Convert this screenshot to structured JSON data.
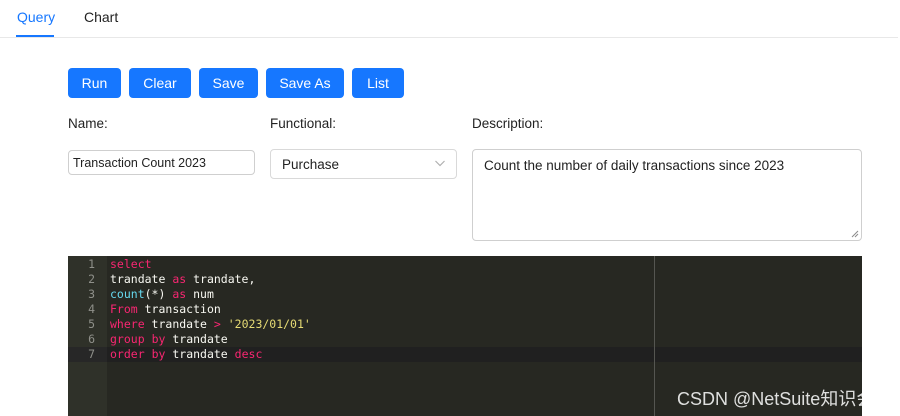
{
  "tabs": {
    "query": "Query",
    "chart": "Chart"
  },
  "toolbar": {
    "run": "Run",
    "clear": "Clear",
    "save": "Save",
    "save_as": "Save As",
    "list": "List"
  },
  "form": {
    "name_label": "Name:",
    "name_value": "Transaction Count 2023",
    "functional_label": "Functional:",
    "functional_value": "Purchase",
    "description_label": "Description:",
    "description_value": "Count the number of daily transactions since 2023"
  },
  "editor": {
    "lines": [
      {
        "n": "1",
        "tokens": [
          {
            "t": "select",
            "c": "kw"
          }
        ]
      },
      {
        "n": "2",
        "tokens": [
          {
            "t": "trandate ",
            "c": ""
          },
          {
            "t": "as",
            "c": "kw"
          },
          {
            "t": " trandate,",
            "c": ""
          }
        ]
      },
      {
        "n": "3",
        "tokens": [
          {
            "t": "count",
            "c": "fn"
          },
          {
            "t": "(*) ",
            "c": ""
          },
          {
            "t": "as",
            "c": "kw"
          },
          {
            "t": " num",
            "c": ""
          }
        ]
      },
      {
        "n": "4",
        "tokens": [
          {
            "t": "From",
            "c": "kw"
          },
          {
            "t": " transaction",
            "c": ""
          }
        ]
      },
      {
        "n": "5",
        "tokens": [
          {
            "t": "where",
            "c": "kw"
          },
          {
            "t": " trandate ",
            "c": ""
          },
          {
            "t": ">",
            "c": "kw"
          },
          {
            "t": " ",
            "c": ""
          },
          {
            "t": "'2023/01/01'",
            "c": "str"
          }
        ]
      },
      {
        "n": "6",
        "tokens": [
          {
            "t": "group",
            "c": "kw"
          },
          {
            "t": " ",
            "c": ""
          },
          {
            "t": "by",
            "c": "kw"
          },
          {
            "t": " trandate",
            "c": ""
          }
        ]
      },
      {
        "n": "7",
        "tokens": [
          {
            "t": "order",
            "c": "kw"
          },
          {
            "t": " ",
            "c": ""
          },
          {
            "t": "by",
            "c": "kw"
          },
          {
            "t": " trandate ",
            "c": ""
          },
          {
            "t": "desc",
            "c": "kw"
          }
        ]
      }
    ]
  },
  "watermark": "CSDN @NetSuite知识会",
  "colors": {
    "accent": "#1677ff",
    "editor_bg": "#272822",
    "keyword": "#f92672",
    "function": "#66d9ef",
    "string": "#e6db74"
  }
}
